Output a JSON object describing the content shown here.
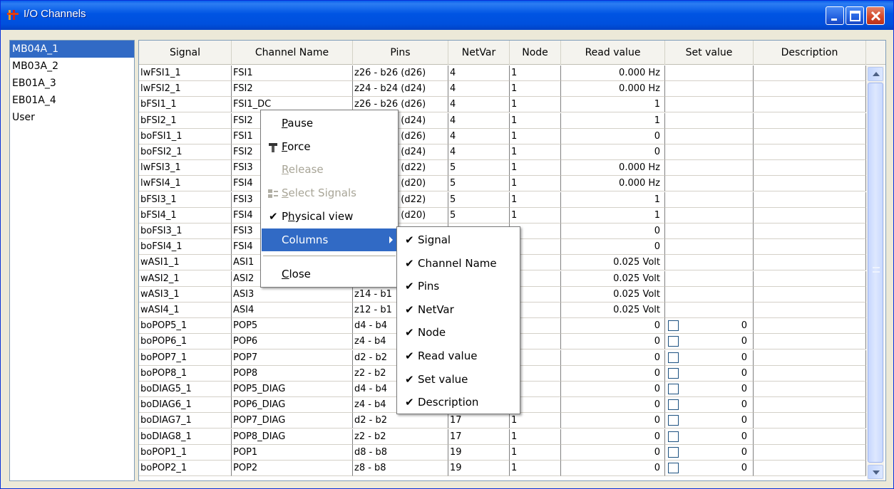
{
  "window": {
    "title": "I/O Channels"
  },
  "left_list": {
    "selected_index": 0,
    "items": [
      "MB04A_1",
      "MB03A_2",
      "EB01A_3",
      "EB01A_4",
      "User"
    ]
  },
  "table": {
    "columns": [
      "Signal",
      "Channel Name",
      "Pins",
      "NetVar",
      "Node",
      "Read value",
      "Set value",
      "Description"
    ],
    "rows": [
      {
        "signal": "lwFSI1_1",
        "channel": "FSI1",
        "pins": "z26 - b26 (d26)",
        "netvar": "4",
        "node": "1",
        "read": "0.000 Hz",
        "set": "",
        "desc": ""
      },
      {
        "signal": "lwFSI2_1",
        "channel": "FSI2",
        "pins": "z24 - b24 (d24)",
        "netvar": "4",
        "node": "1",
        "read": "0.000 Hz",
        "set": "",
        "desc": ""
      },
      {
        "signal": "bFSI1_1",
        "channel": "FSI1_DC",
        "pins": "z26 - b26 (d26)",
        "netvar": "4",
        "node": "1",
        "read": "1",
        "set": "",
        "desc": ""
      },
      {
        "signal": "bFSI2_1",
        "channel": "FSI2",
        "pins": "z24 - b24 (d24)",
        "netvar": "4",
        "node": "1",
        "read": "1",
        "set": "",
        "desc": ""
      },
      {
        "signal": "boFSI1_1",
        "channel": "FSI1",
        "pins": "z26 - b26 (d26)",
        "netvar": "4",
        "node": "1",
        "read": "0",
        "set": "",
        "desc": ""
      },
      {
        "signal": "boFSI2_1",
        "channel": "FSI2",
        "pins": "z24 - b24 (d24)",
        "netvar": "4",
        "node": "1",
        "read": "0",
        "set": "",
        "desc": ""
      },
      {
        "signal": "lwFSI3_1",
        "channel": "FSI3",
        "pins": "z22 - b22 (d22)",
        "netvar": "5",
        "node": "1",
        "read": "0.000 Hz",
        "set": "",
        "desc": ""
      },
      {
        "signal": "lwFSI4_1",
        "channel": "FSI4",
        "pins": "z20 - b20 (d20)",
        "netvar": "5",
        "node": "1",
        "read": "0.000 Hz",
        "set": "",
        "desc": ""
      },
      {
        "signal": "bFSI3_1",
        "channel": "FSI3",
        "pins": "z22 - b22 (d22)",
        "netvar": "5",
        "node": "1",
        "read": "1",
        "set": "",
        "desc": ""
      },
      {
        "signal": "bFSI4_1",
        "channel": "FSI4",
        "pins": "z20 - b20 (d20)",
        "netvar": "5",
        "node": "1",
        "read": "1",
        "set": "",
        "desc": ""
      },
      {
        "signal": "boFSI3_1",
        "channel": "FSI3",
        "pins": "",
        "netvar": "",
        "node": "",
        "read": "0",
        "set": "",
        "desc": ""
      },
      {
        "signal": "boFSI4_1",
        "channel": "FSI4",
        "pins": "",
        "netvar": "",
        "node": "",
        "read": "0",
        "set": "",
        "desc": ""
      },
      {
        "signal": "wASI1_1",
        "channel": "ASI1",
        "pins": "",
        "netvar": "",
        "node": "",
        "read": "0.025 Volt",
        "set": "",
        "desc": ""
      },
      {
        "signal": "wASI2_1",
        "channel": "ASI2",
        "pins": "",
        "netvar": "",
        "node": "",
        "read": "0.025 Volt",
        "set": "",
        "desc": ""
      },
      {
        "signal": "wASI3_1",
        "channel": "ASI3",
        "pins": "z14 - b1",
        "netvar": "",
        "node": "",
        "read": "0.025 Volt",
        "set": "",
        "desc": ""
      },
      {
        "signal": "wASI4_1",
        "channel": "ASI4",
        "pins": "z12 - b1",
        "netvar": "",
        "node": "",
        "read": "0.025 Volt",
        "set": "",
        "desc": ""
      },
      {
        "signal": "boPOP5_1",
        "channel": "POP5",
        "pins": "d4 - b4",
        "netvar": "",
        "node": "",
        "read": "0",
        "set": "0",
        "desc": ""
      },
      {
        "signal": "boPOP6_1",
        "channel": "POP6",
        "pins": "z4 - b4",
        "netvar": "",
        "node": "",
        "read": "0",
        "set": "0",
        "desc": ""
      },
      {
        "signal": "boPOP7_1",
        "channel": "POP7",
        "pins": "d2 - b2",
        "netvar": "",
        "node": "",
        "read": "0",
        "set": "0",
        "desc": ""
      },
      {
        "signal": "boPOP8_1",
        "channel": "POP8",
        "pins": "z2 - b2",
        "netvar": "",
        "node": "",
        "read": "0",
        "set": "0",
        "desc": ""
      },
      {
        "signal": "boDIAG5_1",
        "channel": "POP5_DIAG",
        "pins": "d4 - b4",
        "netvar": "",
        "node": "",
        "read": "0",
        "set": "0",
        "desc": ""
      },
      {
        "signal": "boDIAG6_1",
        "channel": "POP6_DIAG",
        "pins": "z4 - b4",
        "netvar": "",
        "node": "",
        "read": "0",
        "set": "0",
        "desc": ""
      },
      {
        "signal": "boDIAG7_1",
        "channel": "POP7_DIAG",
        "pins": "d2 - b2",
        "netvar": "17",
        "node": "1",
        "read": "0",
        "set": "0",
        "desc": ""
      },
      {
        "signal": "boDIAG8_1",
        "channel": "POP8_DIAG",
        "pins": "z2 - b2",
        "netvar": "17",
        "node": "1",
        "read": "0",
        "set": "0",
        "desc": ""
      },
      {
        "signal": "boPOP1_1",
        "channel": "POP1",
        "pins": "d8 - b8",
        "netvar": "19",
        "node": "1",
        "read": "0",
        "set": "0",
        "desc": ""
      },
      {
        "signal": "boPOP2_1",
        "channel": "POP2",
        "pins": "z8 - b8",
        "netvar": "19",
        "node": "1",
        "read": "0",
        "set": "0",
        "desc": ""
      }
    ]
  },
  "context_menu": {
    "items": [
      {
        "label": "Pause",
        "enabled": true
      },
      {
        "label": "Force",
        "enabled": true
      },
      {
        "label": "Release",
        "enabled": false
      },
      {
        "label": "Select Signals",
        "enabled": false
      },
      {
        "label": "Physical view",
        "checked": true
      },
      {
        "label": "Columns",
        "has_submenu": true,
        "highlighted": true
      },
      {
        "label": "Close",
        "enabled": true
      }
    ]
  },
  "columns_submenu": {
    "items": [
      "Signal",
      "Channel Name",
      "Pins",
      "NetVar",
      "Node",
      "Read value",
      "Set value",
      "Description"
    ],
    "check_glyph": "✔"
  },
  "colors": {
    "selection": "#316AC5",
    "titlebar": "#0054E3",
    "close_button": "#D54A2B"
  }
}
